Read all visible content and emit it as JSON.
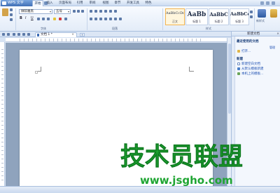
{
  "app": {
    "name": "WPS 文字"
  },
  "menu": [
    {
      "label": "开始",
      "active": true
    },
    {
      "label": "插入"
    },
    {
      "label": "页面布局"
    },
    {
      "label": "引用"
    },
    {
      "label": "审阅"
    },
    {
      "label": "视图"
    },
    {
      "label": "章节"
    },
    {
      "label": "开发工具"
    },
    {
      "label": "特色"
    }
  ],
  "ribbon": {
    "font_name": "微软雅黑",
    "font_size": "五号",
    "groups": {
      "font": "字体",
      "paragraph": "段落",
      "styles": "样式"
    },
    "format_buttons": [
      "B",
      "I",
      "U"
    ],
    "styles": [
      {
        "sample": "AaBbCcDd",
        "caption": "正文"
      },
      {
        "sample": "AaBb",
        "caption": "标题 1"
      },
      {
        "sample": "AaBbC",
        "caption": "标题 2"
      },
      {
        "sample": "AaBbCc",
        "caption": "标题 3"
      }
    ],
    "new_style_label": "新样式"
  },
  "tabs": {
    "doc_title": "文档 1 *",
    "close_glyph": "×",
    "new_tab_glyph": "+"
  },
  "taskpane": {
    "title": "新建文档",
    "close_glyph": "×",
    "recent_heading": "最近使用的文档",
    "manage_label": "管理",
    "open_label": "打开...",
    "new_heading": "新建",
    "links": [
      "新建空白文档",
      "从默认模板新建",
      "本机上的模板..."
    ]
  },
  "watermark": {
    "title": "技术员联盟",
    "url": "www.jsgho.com"
  },
  "colors": {
    "accent": "#3f6fb6",
    "watermark": "#1fa532",
    "link": "#1d4fb1"
  }
}
